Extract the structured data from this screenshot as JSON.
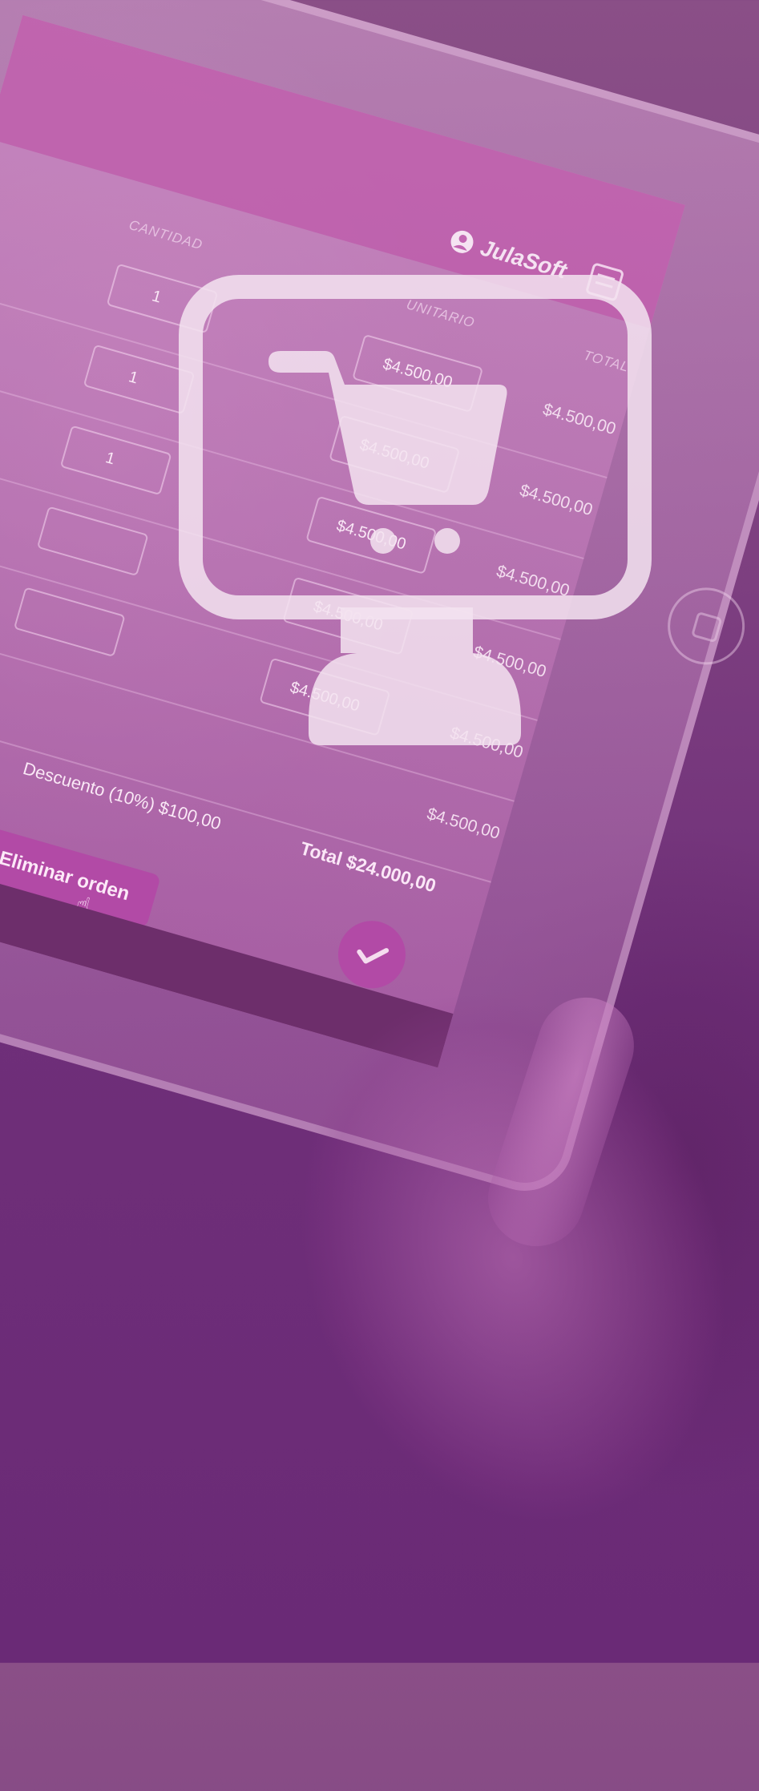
{
  "brand": {
    "name": "JulaSoft"
  },
  "table": {
    "headers": {
      "quantity": "CANTIDAD",
      "unit_price": "UNITARIO",
      "total": "TOTAL"
    },
    "rows": [
      {
        "qty": "1",
        "unit_price": "$4.500,00",
        "total": "$4.500,00"
      },
      {
        "qty": "1",
        "unit_price": "$4.500,00",
        "total": "$4.500,00"
      },
      {
        "qty": "1",
        "unit_price": "$4.500,00",
        "total": "$4.500,00"
      },
      {
        "qty": "",
        "unit_price": "$4.500,00",
        "total": "$4.500,00"
      },
      {
        "qty": "",
        "unit_price": "$4.500,00",
        "total": "$4.500,00"
      },
      {
        "qty": "",
        "unit_price": "",
        "total": "$4.500,00"
      }
    ]
  },
  "summary": {
    "discount": "Descuento (10%) $100,00",
    "total": "Total $24.000,00"
  },
  "actions": {
    "delete_label": "Eliminar orden"
  },
  "icons": [
    "user-icon",
    "menu-icon",
    "pointer-cursor-icon",
    "check-icon",
    "pos-cart-monitor-icon",
    "home-button-icon"
  ],
  "colors": {
    "background": "#7d3f80",
    "accent": "#b24aa6",
    "overlay_icon": "#f3e3f0"
  }
}
